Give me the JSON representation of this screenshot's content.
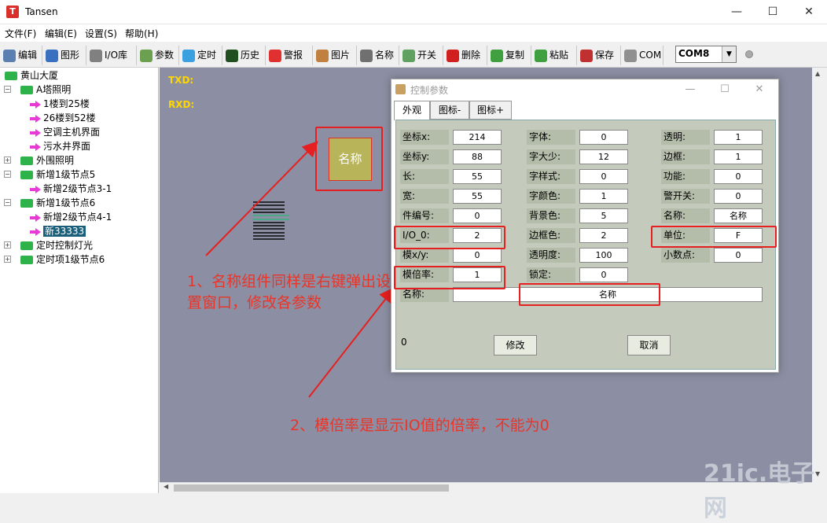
{
  "window": {
    "title": "Tansen",
    "icon_letter": "T",
    "minimize": "—",
    "maximize": "☐",
    "close": "✕"
  },
  "menu": [
    "文件(F)",
    "编辑(E)",
    "设置(S)",
    "帮助(H)"
  ],
  "toolbar": [
    {
      "label": "编辑",
      "icon": "edit-icon",
      "color": "#5a7fb0"
    },
    {
      "label": "图形",
      "icon": "globe-icon",
      "color": "#3a70c0"
    },
    {
      "label": "I/O库",
      "icon": "io-library-icon",
      "color": "#808080"
    },
    {
      "label": "参数",
      "icon": "gear-icon",
      "color": "#6aa050"
    },
    {
      "label": "定时",
      "icon": "snowflake-icon",
      "color": "#3aa0e0"
    },
    {
      "label": "历史",
      "icon": "monitor-icon",
      "color": "#205020"
    },
    {
      "label": "警报",
      "icon": "alarm-icon",
      "color": "#e03030"
    },
    {
      "label": "图片",
      "icon": "picture-icon",
      "color": "#c08040"
    },
    {
      "label": "名称",
      "icon": "name-tool-icon",
      "color": "#707070"
    },
    {
      "label": "开关",
      "icon": "switch-icon",
      "color": "#60a060"
    },
    {
      "label": "删除",
      "icon": "delete-icon",
      "color": "#d02020"
    },
    {
      "label": "复制",
      "icon": "copy-icon",
      "color": "#40a040"
    },
    {
      "label": "粘贴",
      "icon": "paste-icon",
      "color": "#40a040"
    },
    {
      "label": "保存",
      "icon": "save-icon",
      "color": "#c03030"
    },
    {
      "label": "COM",
      "icon": "com-port-icon",
      "color": "#909090"
    }
  ],
  "com": {
    "value": "COM8",
    "arrow": "▼"
  },
  "tree": [
    {
      "label": "黄山大厦",
      "type": "folder",
      "level": 0,
      "exp": ""
    },
    {
      "label": "A塔照明",
      "type": "folder",
      "level": 1,
      "exp": "−"
    },
    {
      "label": "1楼到25楼",
      "type": "leaf",
      "level": 2,
      "exp": ""
    },
    {
      "label": "26楼到52楼",
      "type": "leaf",
      "level": 2,
      "exp": ""
    },
    {
      "label": "空调主机界面",
      "type": "leaf",
      "level": 2,
      "exp": ""
    },
    {
      "label": "污水井界面",
      "type": "leaf",
      "level": 2,
      "exp": ""
    },
    {
      "label": "外围照明",
      "type": "folder",
      "level": 1,
      "exp": "+"
    },
    {
      "label": "新增1级节点5",
      "type": "folder",
      "level": 1,
      "exp": "−"
    },
    {
      "label": "新增2级节点3-1",
      "type": "leaf",
      "level": 2,
      "exp": ""
    },
    {
      "label": "新增1级节点6",
      "type": "folder",
      "level": 1,
      "exp": "−"
    },
    {
      "label": "新增2级节点4-1",
      "type": "leaf",
      "level": 2,
      "exp": ""
    },
    {
      "label": "新33333",
      "type": "leaf",
      "level": 2,
      "exp": "",
      "selected": true
    },
    {
      "label": "定时控制灯光",
      "type": "folder",
      "level": 1,
      "exp": "+"
    },
    {
      "label": "定时项1级节点6",
      "type": "folder",
      "level": 1,
      "exp": "+"
    }
  ],
  "canvas": {
    "txd": "TXD:",
    "rxd": "RXD:",
    "widget_label": "名称"
  },
  "annotations": {
    "note1": "1、名称组件同样是右键弹出设置窗口，修改各参数",
    "note2": "2、模倍率是显示IO值的倍率，不能为0"
  },
  "dialog": {
    "title": "控制参数",
    "tabs": [
      "外观",
      "图标-",
      "图标+"
    ],
    "fields": [
      {
        "label": "坐标x:",
        "value": "214"
      },
      {
        "label": "坐标y:",
        "value": "88"
      },
      {
        "label": "长:",
        "value": "55"
      },
      {
        "label": "宽:",
        "value": "55"
      },
      {
        "label": "件编号:",
        "value": "0"
      },
      {
        "label": "I/O_0:",
        "value": "2"
      },
      {
        "label": "模x/y:",
        "value": "0"
      },
      {
        "label": "模倍率:",
        "value": "1"
      },
      {
        "label": "字体:",
        "value": "0"
      },
      {
        "label": "字大少:",
        "value": "12"
      },
      {
        "label": "字样式:",
        "value": "0"
      },
      {
        "label": "字颜色:",
        "value": "1"
      },
      {
        "label": "背景色:",
        "value": "5"
      },
      {
        "label": "边框色:",
        "value": "2"
      },
      {
        "label": "透明度:",
        "value": "100"
      },
      {
        "label": "锁定:",
        "value": "0"
      },
      {
        "label": "透明:",
        "value": "1"
      },
      {
        "label": "边框:",
        "value": "1"
      },
      {
        "label": "功能:",
        "value": "0"
      },
      {
        "label": "警开关:",
        "value": "0"
      },
      {
        "label": "名称:",
        "value": "名称"
      },
      {
        "label": "单位:",
        "value": "F"
      },
      {
        "label": "小数点:",
        "value": "0"
      }
    ],
    "name_label": "名称:",
    "name_value": "名称",
    "status_value": "0",
    "modify_button": "修改",
    "cancel_button": "取消"
  },
  "watermark": "21ic.电子网",
  "colors": {
    "annotation_red": "#e62020",
    "canvas_bg": "#8c8fa3",
    "rxd_txd": "#ffd700"
  }
}
